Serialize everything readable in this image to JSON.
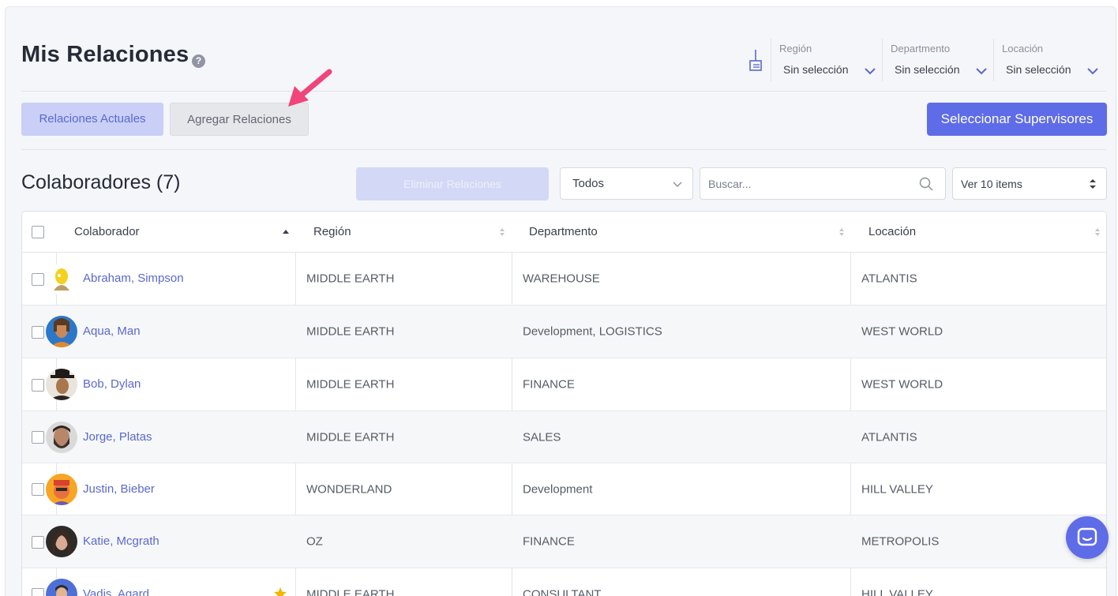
{
  "header": {
    "title": "Mis Relaciones",
    "help_icon": "?"
  },
  "filters": [
    {
      "label": "Región",
      "value": "Sin selección"
    },
    {
      "label": "Departmento",
      "value": "Sin selección"
    },
    {
      "label": "Locación",
      "value": "Sin selección"
    }
  ],
  "tabs": [
    {
      "label": "Relaciones Actuales",
      "active": true
    },
    {
      "label": "Agregar Relaciones",
      "active": false
    }
  ],
  "primary_button": {
    "label": "Seleccionar Supervisores"
  },
  "section": {
    "title": "Colaboradores (7)"
  },
  "toolbar": {
    "delete_label": "Eliminar Relaciones",
    "filter_value": "Todos",
    "search_placeholder": "Buscar...",
    "page_size": "Ver 10 items"
  },
  "table": {
    "columns": [
      "Colaborador",
      "Región",
      "Departmento",
      "Locación"
    ],
    "rows": [
      {
        "name": "Abraham, Simpson",
        "region": "MIDDLE EARTH",
        "department": "WAREHOUSE",
        "location": "ATLANTIS",
        "avatar": "cartoon-yellow",
        "starred": false
      },
      {
        "name": "Aqua, Man",
        "region": "MIDDLE EARTH",
        "department": "Development, LOGISTICS",
        "location": "WEST WORLD",
        "avatar": "photo-blue",
        "starred": false
      },
      {
        "name": "Bob, Dylan",
        "region": "MIDDLE EARTH",
        "department": "FINANCE",
        "location": "WEST WORLD",
        "avatar": "photo-hat",
        "starred": false
      },
      {
        "name": "Jorge, Platas",
        "region": "MIDDLE EARTH",
        "department": "SALES",
        "location": "ATLANTIS",
        "avatar": "photo-beard",
        "starred": false
      },
      {
        "name": "Justin, Bieber",
        "region": "WONDERLAND",
        "department": "Development",
        "location": "HILL VALLEY",
        "avatar": "cartoon-orange",
        "starred": false
      },
      {
        "name": "Katie, Mcgrath",
        "region": "OZ",
        "department": "FINANCE",
        "location": "METROPOLIS",
        "avatar": "photo-dark",
        "starred": false
      },
      {
        "name": "Vadis, Agard",
        "region": "MIDDLE EARTH",
        "department": "CONSULTANT",
        "location": "HILL VALLEY",
        "avatar": "cartoon-blue",
        "starred": true
      }
    ]
  },
  "colors": {
    "accent": "#5f6ce8",
    "link": "#5b69cc",
    "annotation_arrow": "#f0447a",
    "star": "#f4b400"
  },
  "icons": {
    "help": "help-circle-icon",
    "broom": "broom-icon",
    "chevron": "chevron-down-icon",
    "search": "search-icon",
    "sort": "sort-icon",
    "star": "star-icon",
    "chat": "chat-icon"
  }
}
